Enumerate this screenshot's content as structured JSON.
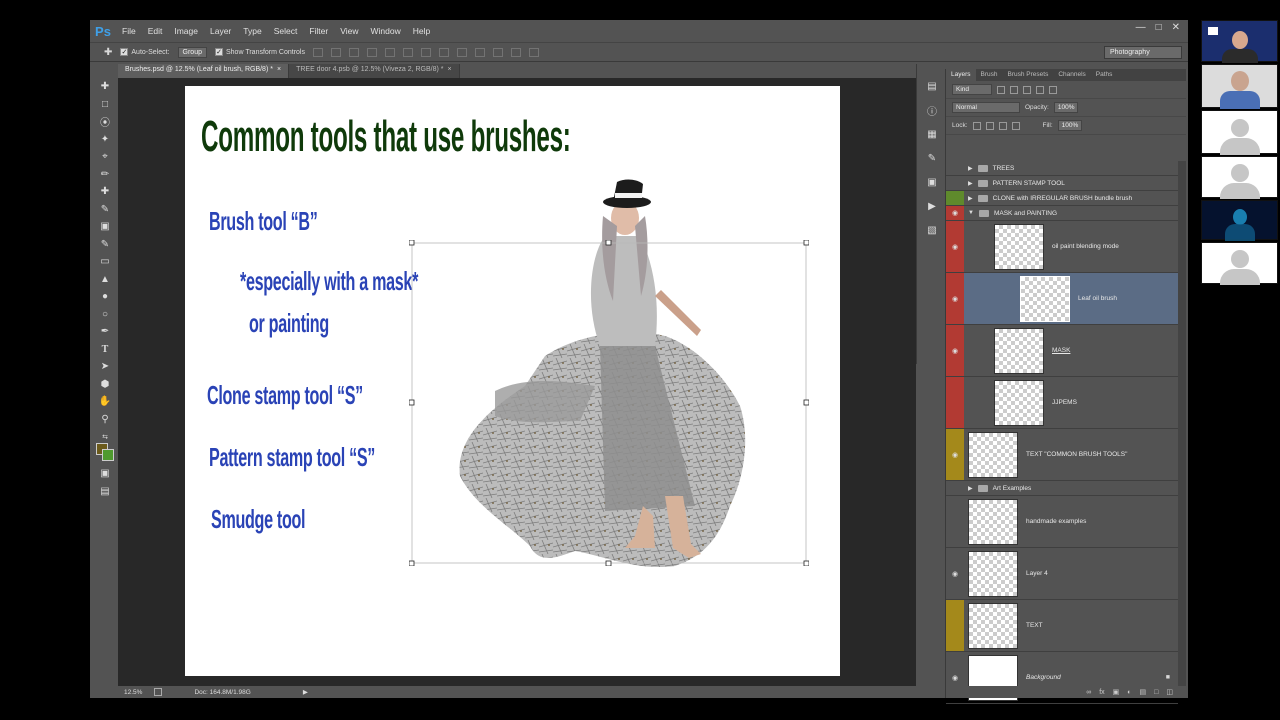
{
  "app": {
    "logo": "Ps"
  },
  "menu": [
    "File",
    "Edit",
    "Image",
    "Layer",
    "Type",
    "Select",
    "Filter",
    "View",
    "Window",
    "Help"
  ],
  "options": {
    "auto_select_label": "Auto-Select:",
    "auto_select_value": "Group",
    "show_transform_label": "Show Transform Controls",
    "workspace": "Photography"
  },
  "doc_tabs": [
    {
      "label": "Brushes.psd @ 12.5% (Leaf oil brush, RGB/8) *",
      "active": true
    },
    {
      "label": "TREE door 4.psb @ 12.5% (Viveza 2, RGB/8) *",
      "active": false
    }
  ],
  "canvas": {
    "title": "Common tools that use brushes:",
    "lines": [
      "Brush tool    “B”",
      "*especially with a mask*",
      "or painting",
      "Clone stamp tool    “S”",
      "Pattern stamp tool    “S”",
      "Smudge tool"
    ]
  },
  "status": {
    "zoom": "12.5%",
    "doc": "Doc: 164.8M/1.98G"
  },
  "panel": {
    "tabs": [
      "Layers",
      "Brush",
      "Brush Presets",
      "Channels",
      "Paths"
    ],
    "kind": "Kind",
    "blend": "Normal",
    "opacity_label": "Opacity:",
    "opacity": "100%",
    "lock_label": "Lock:",
    "fill_label": "Fill:",
    "fill": "100%"
  },
  "layers": [
    {
      "name": "TREES",
      "type": "group",
      "color": "none"
    },
    {
      "name": "PATTERN STAMP TOOL",
      "type": "group",
      "color": "none"
    },
    {
      "name": "CLONE with IRREGULAR BRUSH bundle brush",
      "type": "group",
      "color": "green"
    },
    {
      "name": "MASK and PAINTING",
      "type": "group-open",
      "color": "red"
    },
    {
      "name": "oil paint    blending mode",
      "type": "layer",
      "color": "red"
    },
    {
      "name": "Leaf oil brush",
      "type": "layer",
      "color": "red",
      "selected": true
    },
    {
      "name": "MASK",
      "type": "layer",
      "color": "red"
    },
    {
      "name": "JJPEMS",
      "type": "layer",
      "color": "red"
    },
    {
      "name": "TEXT \"COMMON BRUSH TOOLS\"",
      "type": "layer",
      "color": "yellow"
    },
    {
      "name": "Art Examples",
      "type": "group",
      "color": "none"
    },
    {
      "name": "handmade examples",
      "type": "layer",
      "color": "none"
    },
    {
      "name": "Layer 4",
      "type": "layer",
      "color": "none"
    },
    {
      "name": "TEXT",
      "type": "layer",
      "color": "yellow"
    },
    {
      "name": "Background",
      "type": "background",
      "color": "none"
    }
  ],
  "colors": {
    "red_label": "#b23a33",
    "green_label": "#5f8a2c",
    "yellow_label": "#a4891b",
    "selected": "#5b6c85"
  }
}
